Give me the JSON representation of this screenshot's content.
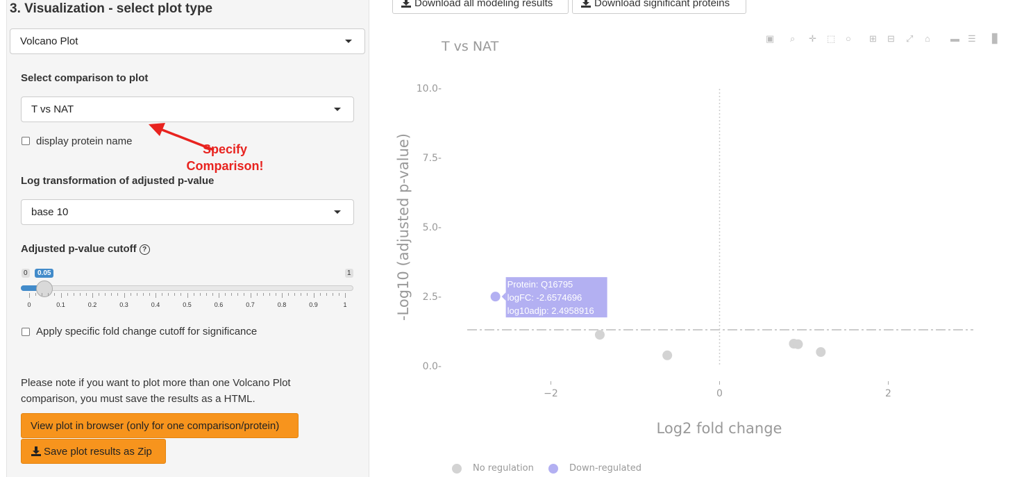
{
  "section": {
    "title": "3. Visualization - select plot type"
  },
  "plot_type_select": {
    "value": "Volcano Plot"
  },
  "comparison": {
    "label": "Select comparison to plot",
    "value": "T vs NAT"
  },
  "display_protein_name": {
    "label": "display protein name",
    "checked": false
  },
  "annotation": {
    "line1": "Specify",
    "line2": "Comparison!"
  },
  "log_transform": {
    "label": "Log transformation of adjusted p-value",
    "value": "base 10"
  },
  "pvalue_cutoff": {
    "label": "Adjusted p-value cutoff",
    "help_icon": "question-circle-icon",
    "min": "0",
    "max": "1",
    "value": "0.05",
    "value_fraction": 0.05,
    "ticks": [
      "0",
      "0.1",
      "0.2",
      "0.3",
      "0.4",
      "0.5",
      "0.6",
      "0.7",
      "0.8",
      "0.9",
      "1"
    ]
  },
  "fold_change_cutoff": {
    "label": "Apply specific fold change cutoff for significance",
    "checked": false
  },
  "note": "Please note if you want to plot more than one Volcano Plot comparison, you must save the results as a HTML.",
  "buttons": {
    "view_browser": "View plot in browser (only for one comparison/protein)",
    "save_zip": "Save plot results as Zip",
    "download_all": "Download all modeling results",
    "download_significant": "Download significant proteins"
  },
  "modebar": [
    "camera-icon",
    "zoom-icon",
    "pan-icon",
    "box-select-icon",
    "lasso-icon",
    "zoom-in-icon",
    "zoom-out-icon",
    "autoscale-icon",
    "home-icon",
    "spike-icon",
    "compare-icon",
    "plotly-logo-icon"
  ],
  "colors": {
    "accent": "#428bca",
    "orange": "#f7941d",
    "annotation": "#e8231f",
    "no_regulation": "#d3d3d3",
    "down_regulated": "#b3b0f2"
  },
  "tooltip": {
    "line1": "Protein: Q16795",
    "line2": "logFC: -2.6574696",
    "line3": "log10adjp:  2.4958916"
  },
  "chart_data": {
    "type": "scatter",
    "title": "T vs NAT",
    "xlabel": "Log2 fold change",
    "ylabel": "-Log10 (adjusted p-value)",
    "xlim": [
      -3.3,
      3.2
    ],
    "ylim": [
      -0.6,
      10.5
    ],
    "xticks": [
      -2,
      0,
      2
    ],
    "yticks": [
      0,
      2.5,
      5,
      7.5,
      10
    ],
    "xtick_labels": [
      "−2",
      "0",
      "2"
    ],
    "ytick_labels": [
      "0.0",
      "2.5",
      "5.0",
      "7.5",
      "10.0"
    ],
    "hline": 1.3,
    "vline": 0,
    "legend": "bottom",
    "series": [
      {
        "name": "No regulation",
        "color": "#d3d3d3",
        "points": [
          [
            -1.42,
            1.12
          ],
          [
            -0.62,
            0.38
          ],
          [
            0.88,
            0.8
          ],
          [
            0.93,
            0.78
          ],
          [
            1.2,
            0.5
          ]
        ]
      },
      {
        "name": "Down-regulated",
        "color": "#b3b0f2",
        "points": [
          [
            -2.6574696,
            2.4958916
          ]
        ]
      }
    ]
  }
}
